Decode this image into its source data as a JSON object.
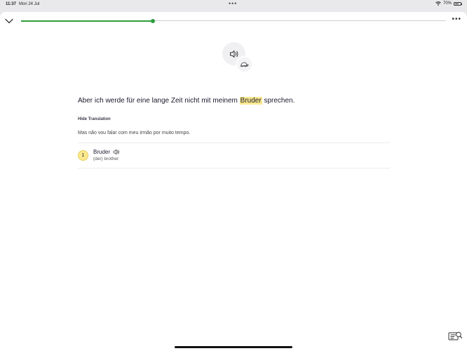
{
  "status_bar": {
    "time": "11:37",
    "date": "Mon 24 Jul",
    "battery_text": "70%",
    "battery_level": 0.7
  },
  "lesson": {
    "progress": 0.31,
    "sentence_before": "Aber ich werde für eine lange Zeit nicht mit meinem ",
    "sentence_highlight": "Bruder",
    "sentence_after": " sprechen.",
    "hide_translation_label": "Hide Translation",
    "translation": "Mas não vou falar com meu irmão por muito tempo.",
    "vocab": [
      {
        "number": "1",
        "word": "Bruder",
        "meaning": "(der) brother"
      }
    ]
  },
  "colors": {
    "progress_green": "#2e9e3e",
    "highlight_yellow": "#fbe98f"
  },
  "icons": {
    "collapse": "chevron-down-icon",
    "more": "ellipsis-icon",
    "audio": "speaker-icon",
    "slow": "turtle-icon",
    "review": "review-list-icon"
  }
}
